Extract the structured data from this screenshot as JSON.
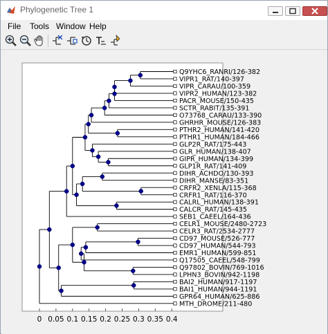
{
  "window": {
    "title": "Phylogenetic Tree 1",
    "controls": {
      "minimize": "minimize",
      "maximize": "maximize",
      "close": "close"
    }
  },
  "menu": [
    "File",
    "Tools",
    "Window",
    "Help"
  ],
  "toolbar": {
    "tools": [
      "zoom-in-icon",
      "zoom-out-icon",
      "pan-hand-icon",
      "prune-icon",
      "collapse-icon",
      "rotate-icon",
      "rename-icon",
      "select-icon"
    ]
  },
  "colors": {
    "node": "#00008b",
    "branch": "#000000",
    "axes_bg": "#ffffff",
    "figure_bg": "#f0f0f0"
  },
  "chart_data": {
    "type": "phylogenetic-tree",
    "x_ticks": [
      "0",
      "0.05",
      "0.1",
      "0.15",
      "0.2",
      "0.25",
      "0.3",
      "0.35",
      "0.4"
    ],
    "xlim": [
      -0.05,
      0.42
    ],
    "leaves": [
      "Q9YHC6_RANRI/126-382",
      "VIPR1_RAT/140-397",
      "VIPR_CARAU/100-359",
      "VIPR2_HUMAN/123-382",
      "PACR_MOUSE/150-435",
      "SCTR_RABIT/135-391",
      "O73768_CARAU/133-390",
      "GHRHR_MOUSE/126-383",
      "PTHR2_HUMAN/141-420",
      "PTHR1_HUMAN/184-466",
      "GLP2R_RAT/175-443",
      "GLR_HUMAN/138-407",
      "GIPR_HUMAN/134-399",
      "GLP1R_RAT/141-409",
      "DIHR_ACHDO/130-393",
      "DIHR_MANSE/83-351",
      "CRFR2_XENLA/115-368",
      "CRFR1_RAT/116-370",
      "CALRL_HUMAN/138-391",
      "CALCR_RAT/145-435",
      "SEB1_CAEEL/164-436",
      "CELR1_MOUSE/2480-2723",
      "CELR3_RAT/2534-2777",
      "CD97_MOUSE/526-777",
      "CD97_HUMAN/544-793",
      "EMR1_HUMAN/599-851",
      "Q17505_CAEEL/548-799",
      "Q97802_BOVIN/769-1016",
      "LPHN3_BOVIN/942-1198",
      "BAI2_HUMAN/917-1197",
      "BAI1_HUMAN/944-1191",
      "GPR64_HUMAN/625-886",
      "MTH_DROME/211-480"
    ],
    "leaf_x": [
      0.41,
      0.41,
      0.41,
      0.41,
      0.41,
      0.41,
      0.41,
      0.41,
      0.41,
      0.41,
      0.41,
      0.41,
      0.41,
      0.41,
      0.41,
      0.41,
      0.41,
      0.41,
      0.41,
      0.41,
      0.41,
      0.41,
      0.41,
      0.41,
      0.41,
      0.41,
      0.41,
      0.41,
      0.41,
      0.41,
      0.41,
      0.41,
      0.41
    ],
    "nodes": [
      {
        "x": 0.305,
        "kids": [
          "L0",
          "L1"
        ]
      },
      {
        "x": 0.275,
        "kids": [
          "N0",
          "L2"
        ]
      },
      {
        "x": 0.227,
        "kids": [
          "N1",
          "L3"
        ]
      },
      {
        "x": 0.227,
        "kids": [
          "N2",
          "L4"
        ]
      },
      {
        "x": 0.21,
        "kids": [
          "N3",
          "L5"
        ]
      },
      {
        "x": 0.197,
        "kids": [
          "N4",
          "L6"
        ]
      },
      {
        "x": 0.157,
        "kids": [
          "N5",
          "L7"
        ]
      },
      {
        "x": 0.236,
        "kids": [
          "L8",
          "L9"
        ]
      },
      {
        "x": 0.148,
        "kids": [
          "N6",
          "N7"
        ]
      },
      {
        "x": 0.208,
        "kids": [
          "L12",
          "L13"
        ]
      },
      {
        "x": 0.178,
        "kids": [
          "L11",
          "N9"
        ]
      },
      {
        "x": 0.16,
        "kids": [
          "L10",
          "N10"
        ]
      },
      {
        "x": 0.138,
        "kids": [
          "N8",
          "N11"
        ]
      },
      {
        "x": 0.19,
        "kids": [
          "L14",
          "L15"
        ]
      },
      {
        "x": 0.307,
        "kids": [
          "L16",
          "L17"
        ]
      },
      {
        "x": 0.13,
        "kids": [
          "N13",
          "N14"
        ]
      },
      {
        "x": 0.233,
        "kids": [
          "L18",
          "L19"
        ]
      },
      {
        "x": 0.112,
        "kids": [
          "N15",
          "N16"
        ]
      },
      {
        "x": 0.1,
        "kids": [
          "N12",
          "N17"
        ]
      },
      {
        "x": 0.082,
        "kids": [
          "N18",
          "L20"
        ]
      },
      {
        "x": 0.175,
        "kids": [
          "L21",
          "L22"
        ]
      },
      {
        "x": 0.298,
        "kids": [
          "L23",
          "L24"
        ]
      },
      {
        "x": 0.14,
        "kids": [
          "N21",
          "L25"
        ]
      },
      {
        "x": 0.126,
        "kids": [
          "N22",
          "L26"
        ]
      },
      {
        "x": 0.283,
        "kids": [
          "L27",
          "L28"
        ]
      },
      {
        "x": 0.135,
        "kids": [
          "N23",
          "N24"
        ]
      },
      {
        "x": 0.1,
        "kids": [
          "N20",
          "N25"
        ]
      },
      {
        "x": 0.285,
        "kids": [
          "L29",
          "L30"
        ]
      },
      {
        "x": 0.066,
        "kids": [
          "N27",
          "L31"
        ]
      },
      {
        "x": 0.058,
        "kids": [
          "N26",
          "N28"
        ]
      },
      {
        "x": 0.03,
        "kids": [
          "N19",
          "N29"
        ]
      },
      {
        "x": 0.0,
        "kids": [
          "N30",
          "L32"
        ]
      }
    ]
  }
}
